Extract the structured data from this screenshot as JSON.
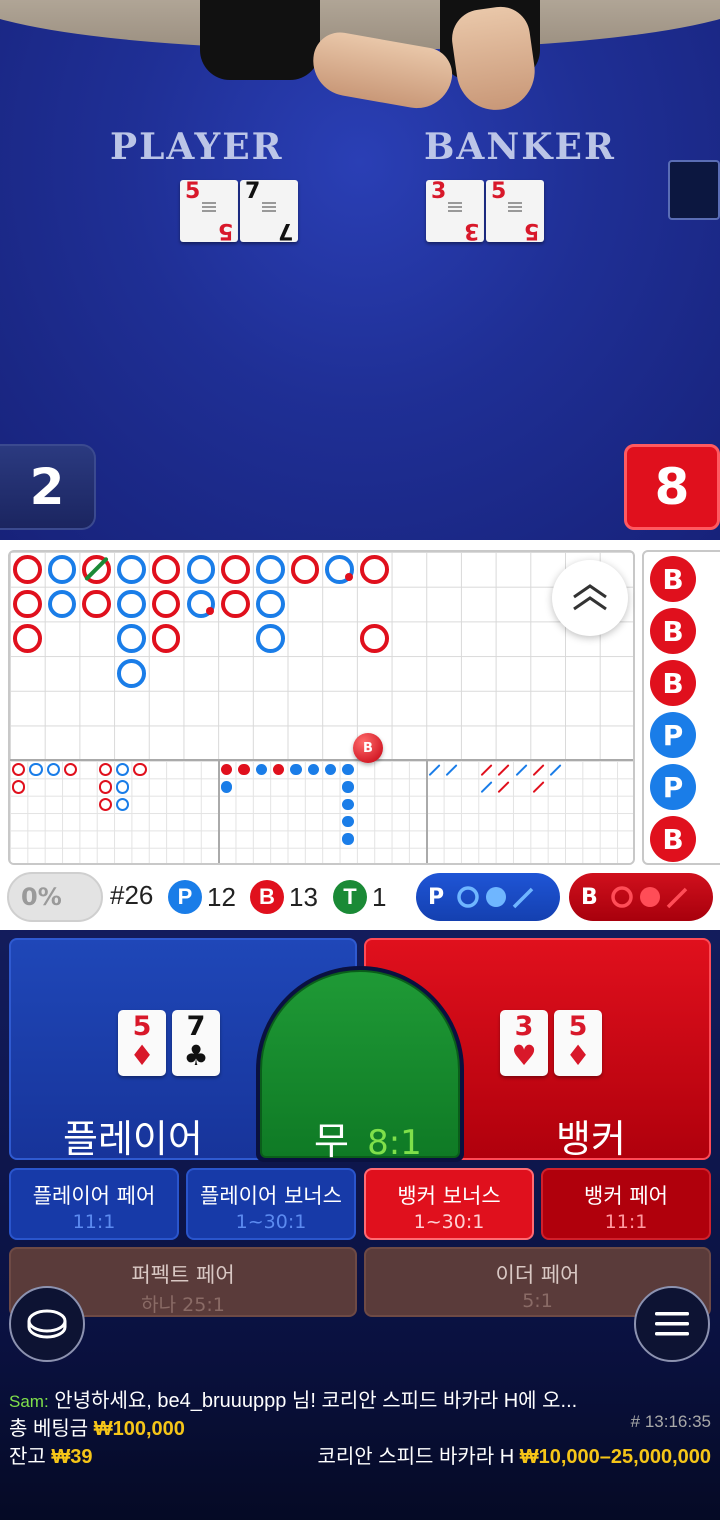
{
  "video": {
    "player_title": "PLAYER",
    "banker_title": "BANKER",
    "player_cards": [
      {
        "value": "5",
        "suit": "♦",
        "color": "#d8182a"
      },
      {
        "value": "7",
        "suit": "♣",
        "color": "#111111"
      }
    ],
    "banker_cards": [
      {
        "value": "3",
        "suit": "♥",
        "color": "#d8182a"
      },
      {
        "value": "5",
        "suit": "♦",
        "color": "#d8182a"
      }
    ],
    "player_score": "2",
    "banker_score": "8"
  },
  "roadmap": {
    "big_road": [
      [
        "B",
        "B",
        "B",
        null,
        null,
        null
      ],
      [
        "P",
        "P",
        null,
        null,
        null,
        null
      ],
      [
        "Btie",
        "B",
        null,
        null,
        null,
        null
      ],
      [
        "P",
        "P",
        "P",
        "P",
        null,
        null
      ],
      [
        "B",
        "B",
        "B",
        null,
        null,
        null
      ],
      [
        "P",
        "Pdot",
        null,
        null,
        null,
        null
      ],
      [
        "B",
        "B",
        null,
        null,
        null,
        null
      ],
      [
        "P",
        "P",
        "P",
        null,
        null,
        null
      ],
      [
        "B",
        null,
        null,
        null,
        null,
        null
      ],
      [
        "Pdot",
        null,
        null,
        null,
        null,
        null
      ],
      [
        "B",
        null,
        "B",
        null,
        null,
        null
      ]
    ],
    "big_eye_road": [
      [
        "B",
        "B",
        "",
        "",
        "",
        ""
      ],
      [
        "P",
        "",
        "",
        "",
        "",
        ""
      ],
      [
        "P",
        "",
        "",
        "",
        "",
        ""
      ],
      [
        "B",
        "",
        "",
        "",
        "",
        ""
      ],
      [
        "",
        "",
        "",
        "",
        "",
        ""
      ],
      [
        "B",
        "B",
        "B",
        "",
        "",
        ""
      ],
      [
        "P",
        "P",
        "P",
        "",
        "",
        ""
      ],
      [
        "B",
        "",
        "",
        "",
        "",
        ""
      ]
    ],
    "small_road": [
      [
        "B",
        "P"
      ],
      [
        "B",
        ""
      ],
      [
        "P",
        ""
      ],
      [
        "B",
        ""
      ],
      [
        "P",
        ""
      ],
      [
        "P",
        ""
      ],
      [
        "P",
        ""
      ],
      [
        "P",
        "P",
        "P",
        "P",
        "P"
      ]
    ],
    "cockroach_road": [
      [
        "P",
        ""
      ],
      [
        "P",
        ""
      ],
      [
        "",
        ""
      ],
      [
        "B",
        "P"
      ],
      [
        "B",
        "B"
      ],
      [
        "P",
        ""
      ],
      [
        "B",
        "B"
      ],
      [
        "P",
        ""
      ]
    ],
    "predict_label": "B",
    "side_road": [
      "B",
      "B",
      "B",
      "P",
      "P",
      "B"
    ],
    "side_road_colors": {
      "B": "#e0101d",
      "P": "#1a7de8"
    }
  },
  "stats": {
    "percent_toggle": "0%",
    "round_count": "#26",
    "player_label": "P",
    "player_count": "12",
    "banker_label": "B",
    "banker_count": "13",
    "tie_label": "T",
    "tie_count": "1",
    "player_predict_label": "P",
    "banker_predict_label": "B"
  },
  "colors": {
    "player_blue": "#1a7de8",
    "banker_red": "#e0101d",
    "tie_green": "#1a8a36"
  },
  "betting": {
    "player_label": "플레이어",
    "banker_label": "뱅커",
    "tie_label": "무",
    "tie_odds": "8:1",
    "player_cards": [
      {
        "value": "5",
        "suit": "♦",
        "color": "#d8182a"
      },
      {
        "value": "7",
        "suit": "♣",
        "color": "#111111"
      }
    ],
    "banker_cards": [
      {
        "value": "3",
        "suit": "♥",
        "color": "#d8182a"
      },
      {
        "value": "5",
        "suit": "♦",
        "color": "#d8182a"
      }
    ],
    "side_bets": [
      {
        "name": "플레이어 페어",
        "odds": "11:1"
      },
      {
        "name": "플레이어 보너스",
        "odds": "1~30:1"
      },
      {
        "name": "뱅커 보너스",
        "odds": "1~30:1"
      },
      {
        "name": "뱅커 페어",
        "odds": "11:1"
      }
    ],
    "perfect_pair": {
      "name": "퍼펙트 페어",
      "odds": "하나 25:1"
    },
    "either_pair": {
      "name": "이더 페어",
      "odds": "5:1"
    }
  },
  "chat": {
    "sender": "Sam:",
    "message": " 안녕하세요, be4_bruuuppp 님! 코리안 스피드 바카라 H에 오..."
  },
  "footer": {
    "total_bet_label": "총 베팅금",
    "total_bet_value": "₩100,000",
    "round_id": "# 13:16:35",
    "balance_label": "잔고",
    "balance_value": "₩39",
    "table_name": "코리안 스피드 바카라 H",
    "table_limits": "₩10,000–25,000,000"
  }
}
